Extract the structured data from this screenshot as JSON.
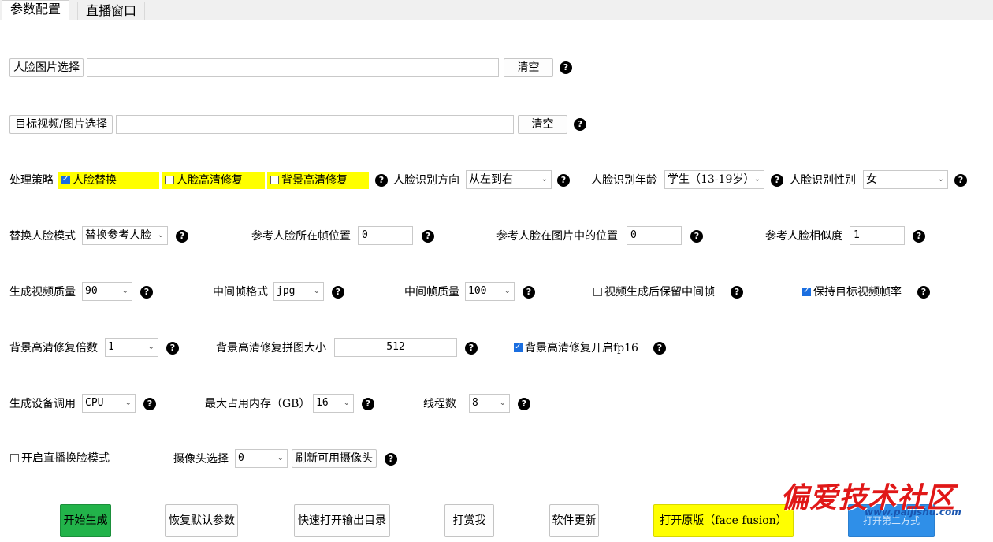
{
  "tabs": [
    {
      "label": "参数配置",
      "active": true
    },
    {
      "label": "直播窗口",
      "active": false
    }
  ],
  "row_face": {
    "select_button": "人脸图片选择",
    "path_value": "",
    "clear_button": "清空"
  },
  "row_target": {
    "select_button": "目标视频/图片选择",
    "path_value": "",
    "clear_button": "清空"
  },
  "row_strategy": {
    "label": "处理策略",
    "opt_face_swap": {
      "label": "人脸替换",
      "checked": true
    },
    "opt_face_enhance": {
      "label": "人脸高清修复",
      "checked": false
    },
    "opt_bg_enhance": {
      "label": "背景高清修复",
      "checked": false
    },
    "direction_label": "人脸识别方向",
    "direction_value": "从左到右",
    "age_label": "人脸识别年龄",
    "age_value": "学生（13-19岁）",
    "gender_label": "人脸识别性别",
    "gender_value": "女"
  },
  "row_ref": {
    "mode_label": "替换人脸模式",
    "mode_value": "替换参考人脸",
    "frame_pos_label": "参考人脸所在帧位置",
    "frame_pos_value": "0",
    "img_pos_label": "参考人脸在图片中的位置",
    "img_pos_value": "0",
    "similarity_label": "参考人脸相似度",
    "similarity_value": "1"
  },
  "row_quality": {
    "video_quality_label": "生成视频质量",
    "video_quality_value": "90",
    "frame_format_label": "中间帧格式",
    "frame_format_value": "jpg",
    "frame_quality_label": "中间帧质量",
    "frame_quality_value": "100",
    "keep_frames": {
      "label": "视频生成后保留中间帧",
      "checked": false
    },
    "keep_fps": {
      "label": "保持目标视频帧率",
      "checked": true
    }
  },
  "row_bg": {
    "scale_label": "背景高清修复倍数",
    "scale_value": "1",
    "tile_label": "背景高清修复拼图大小",
    "tile_value": "512",
    "fp16": {
      "label": "背景高清修复开启fp16",
      "checked": true
    }
  },
  "row_device": {
    "device_label": "生成设备调用",
    "device_value": "CPU",
    "memory_label": "最大占用内存（GB）",
    "memory_value": "16",
    "threads_label": "线程数",
    "threads_value": "8"
  },
  "row_live": {
    "live_mode": {
      "label": "开启直播换脸模式",
      "checked": false
    },
    "camera_label": "摄像头选择",
    "camera_value": "0",
    "refresh_button": "刷新可用摄像头"
  },
  "actions": {
    "start": "开始生成",
    "restore": "恢复默认参数",
    "open_output": "快速打开输出目录",
    "reward": "打赏我",
    "update": "软件更新",
    "open_original": "打开原版（face fusion）",
    "partial_button": "打开第二方式"
  },
  "help_glyph": "?",
  "watermark": {
    "title": "偏爱技术社区",
    "url": "www.paijishu.com"
  },
  "colors": {
    "highlight_yellow": "#ffff00",
    "start_green": "#22b34a",
    "open_original_yellow": "#ffff00",
    "blue_button": "#2f8fe8",
    "checkbox_blue": "#1a6ee0"
  }
}
